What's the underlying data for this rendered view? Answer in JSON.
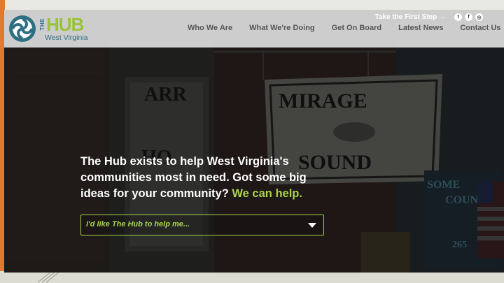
{
  "site": {
    "logo": {
      "the": "THE",
      "hub": "HUB",
      "subtitle": "West Virginia"
    },
    "utility": {
      "cta_label": "Take the First Step →",
      "social_icons": [
        "twitter-icon",
        "facebook-icon",
        "instagram-icon"
      ]
    },
    "nav": [
      {
        "label": "Who We Are"
      },
      {
        "label": "What We're Doing"
      },
      {
        "label": "Get On Board"
      },
      {
        "label": "Latest News"
      },
      {
        "label": "Contact Us"
      }
    ]
  },
  "hero": {
    "headline_main": "The Hub exists to help West Virginia's communities most in need. Got some big ideas for your community?",
    "headline_accent": "We can help.",
    "select": {
      "selected_label": "I'd like The Hub to help me..."
    },
    "sign_text": {
      "top": "MIRAGE",
      "bottom": "SOUND",
      "left_top": "ARR",
      "left_bottom": "HO",
      "right_top": "SOME",
      "right_mid": "COUN",
      "right_num": "265"
    }
  },
  "colors": {
    "accent_green": "#a8d34a",
    "brand_blue": "#2e6f84",
    "slide_accent_orange": "#e07a2f"
  }
}
